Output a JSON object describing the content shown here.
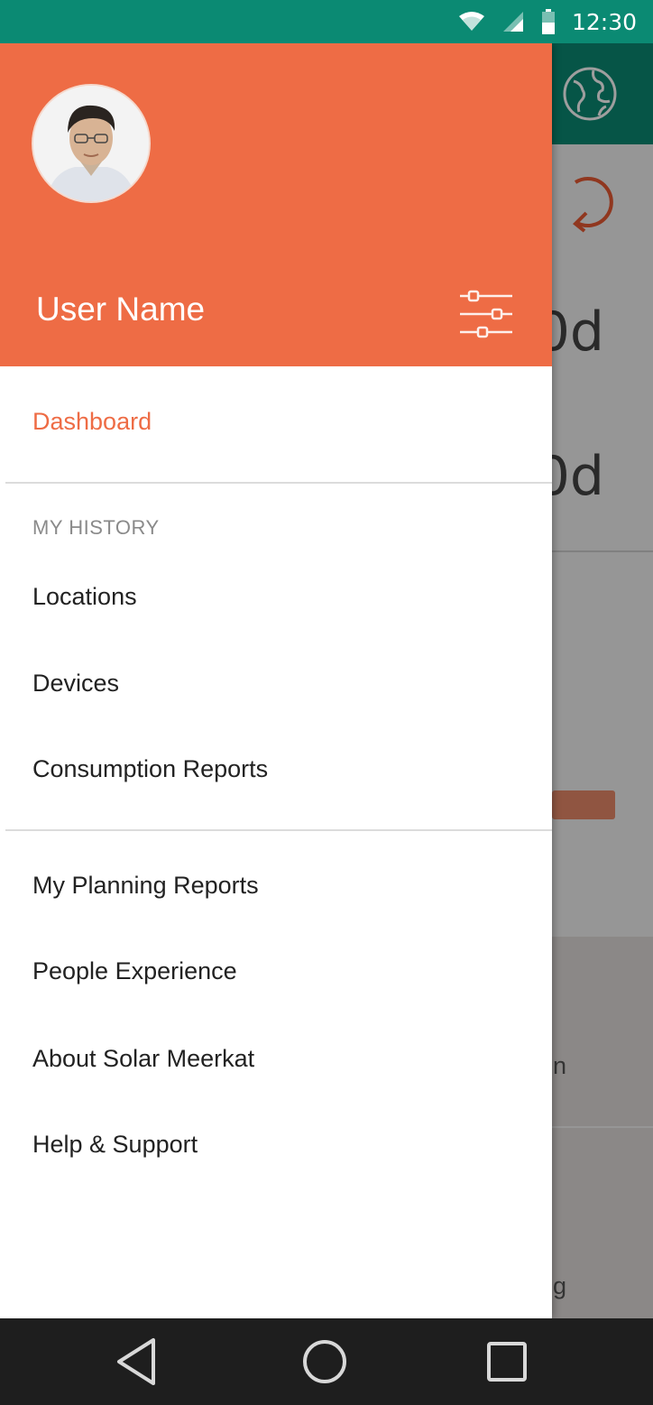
{
  "status_bar": {
    "time": "12:30",
    "icons": [
      "wifi-icon",
      "cell-signal-icon",
      "battery-icon"
    ]
  },
  "background_app": {
    "values": [
      "0d",
      "0d"
    ],
    "partial_texts": [
      "n",
      "ng"
    ]
  },
  "drawer": {
    "user_name": "User Name",
    "avatar": "avatar",
    "settings_icon": "sliders-icon",
    "items": [
      {
        "label": "Dashboard",
        "active": true
      },
      {
        "label": "Locations"
      },
      {
        "label": "Devices"
      },
      {
        "label": "Consumption Reports"
      },
      {
        "label": "My Planning Reports"
      },
      {
        "label": "People Experience"
      },
      {
        "label": "About Solar Meerkat"
      },
      {
        "label": "Help & Support"
      }
    ],
    "section_my_history": "MY HISTORY"
  },
  "nav_bar": {
    "buttons": [
      "back-icon",
      "home-icon",
      "recents-icon"
    ]
  },
  "colors": {
    "status_bar": "#0b8a73",
    "accent": "#ee6c45",
    "navbar": "#1e1e1e"
  }
}
